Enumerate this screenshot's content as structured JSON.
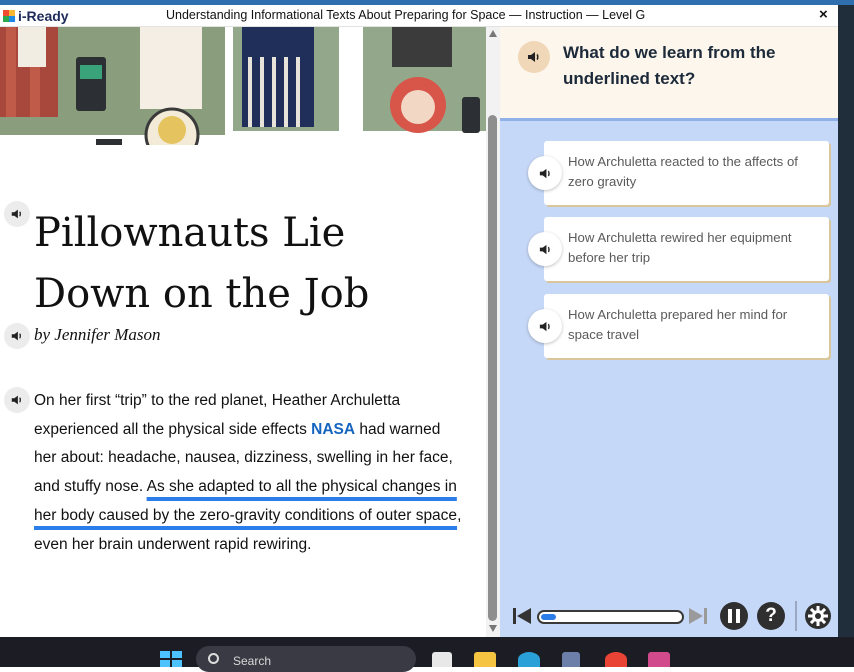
{
  "app": {
    "logo_text": "i-Ready",
    "window_title": "Understanding Informational Texts About Preparing for Space — Instruction — Level G",
    "close_label": "×"
  },
  "article": {
    "title": "Pillownauts Lie Down on the Job",
    "byline": "by Jennifer Mason",
    "body_part1": "On her first “trip” to the red planet, Heather Archuletta experienced all the physical side effects ",
    "nasa": "NASA",
    "body_part2": " had warned her about: headache, nausea, dizziness, swelling in her face, and stuffy nose. ",
    "underlined": "As she adapted to all the physical changes in her body caused by the zero-gravity conditions of outer space",
    "body_part3": ", even her brain underwent rapid rewiring."
  },
  "question": {
    "text": "What do we learn from the underlined text?",
    "choices": [
      {
        "label": "How Archuletta reacted to the affects of zero gravity"
      },
      {
        "label": "How Archuletta rewired her equipment before her trip"
      },
      {
        "label": "How Archuletta prepared her mind for space travel"
      }
    ]
  },
  "controls": {
    "progress_fraction": 0.11,
    "help_label": "?"
  },
  "taskbar": {
    "search_label": "Search"
  },
  "colors": {
    "accent_blue": "#2b7de9",
    "question_bg": "#c6d8f7",
    "question_head_bg": "#fdf6ec",
    "title_bar_blue": "#2f6fb0"
  },
  "icons": [
    "speaker-icon",
    "skip-back-icon",
    "skip-forward-icon",
    "pause-icon",
    "help-icon",
    "gear-icon",
    "windows-icon",
    "search-icon",
    "close-icon"
  ]
}
